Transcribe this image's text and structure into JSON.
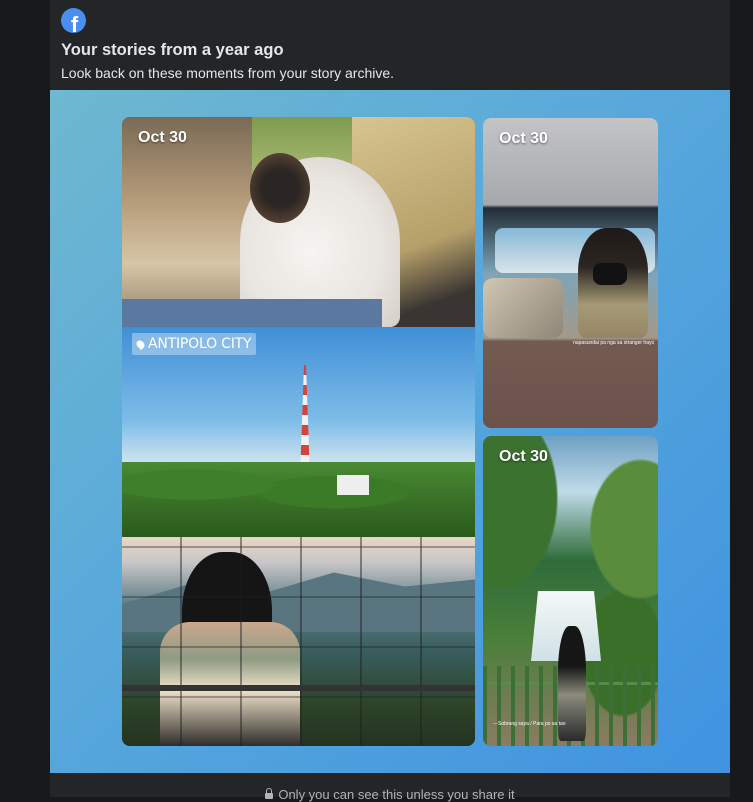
{
  "header": {
    "title": "Your stories from a year ago",
    "subtitle": "Look back on these moments from your story archive."
  },
  "stories": [
    {
      "date": "Oct 30",
      "location_sticker": "ANTIPOLO CITY"
    },
    {
      "date": "Oct 30",
      "caption": "napasundai pa nga sa stranger hays"
    },
    {
      "date": "Oct 30",
      "caption": "---Sobrang saya / Para po sa tao"
    }
  ],
  "footer": {
    "privacy_note": "Only you can see this unless you share it"
  },
  "icons": {
    "brand": "facebook-icon",
    "location": "location-pin-icon",
    "privacy": "lock-icon"
  },
  "colors": {
    "brand_blue": "#4a8ef0",
    "panel_bg": "#242526",
    "page_bg": "#18191a",
    "text_primary": "#e4e6eb",
    "text_secondary": "#b0b3b8"
  }
}
